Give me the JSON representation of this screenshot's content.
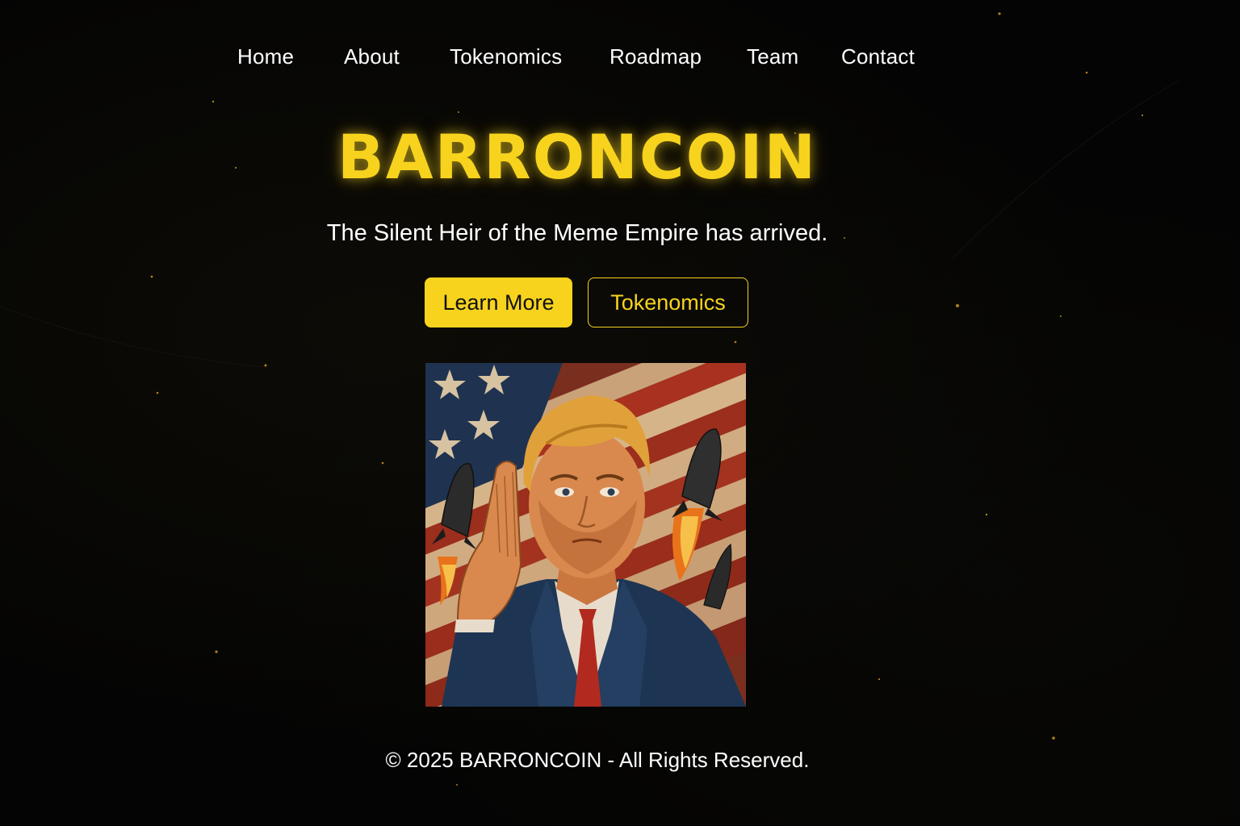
{
  "nav": {
    "items": [
      {
        "label": "Home"
      },
      {
        "label": "About"
      },
      {
        "label": "Tokenomics"
      },
      {
        "label": "Roadmap"
      },
      {
        "label": "Team"
      },
      {
        "label": "Contact"
      }
    ]
  },
  "hero": {
    "title": "BARRONCOIN",
    "subtitle": "The Silent Heir of the Meme Empire has arrived.",
    "primary_button": "Learn More",
    "secondary_button": "Tokenomics",
    "image_icon": "saluting-figure-illustration"
  },
  "footer": {
    "copyright": "© 2025 BARRONCOIN - All Rights Reserved."
  },
  "colors": {
    "accent": "#f7d31e",
    "background": "#040404",
    "text": "#ffffff"
  }
}
